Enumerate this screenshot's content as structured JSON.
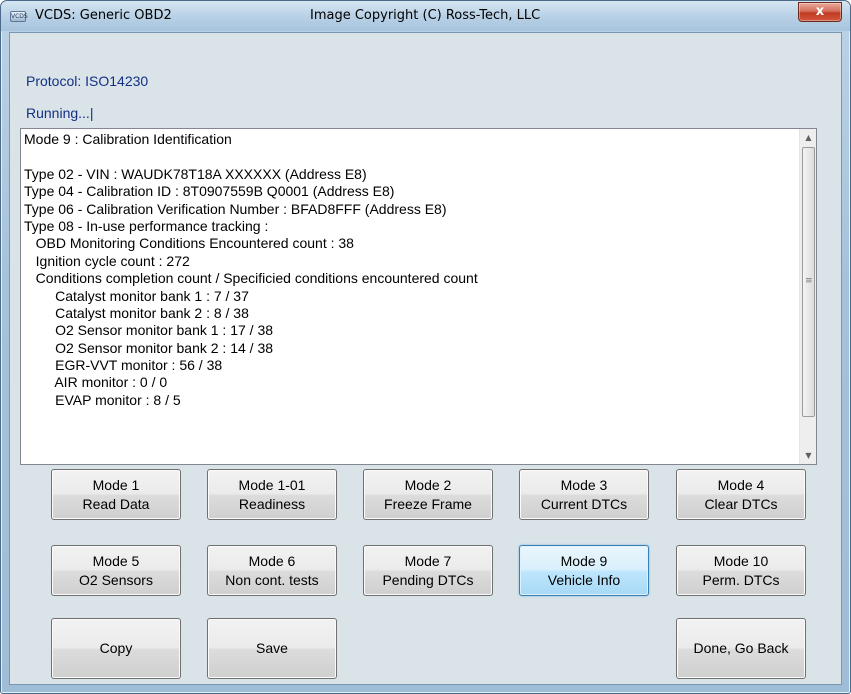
{
  "window": {
    "app_icon_label": "VCDS",
    "title": "VCDS:  Generic OBD2",
    "copyright": "Image Copyright (C) Ross-Tech, LLC",
    "close_glyph": "x"
  },
  "status": {
    "protocol": "Protocol: ISO14230",
    "running": "Running...|"
  },
  "output": {
    "lines": [
      "Mode 9 : Calibration Identification",
      "",
      "Type 02 - VIN : WAUDK78T18A XXXXXX (Address E8)",
      "Type 04 - Calibration ID : 8T0907559B Q0001 (Address E8)",
      "Type 06 - Calibration Verification Number : BFAD8FFF (Address E8)",
      "Type 08 - In-use performance tracking :",
      "   OBD Monitoring Conditions Encountered count : 38",
      "   Ignition cycle count : 272",
      "   Conditions completion count / Specificied conditions encountered count",
      "        Catalyst monitor bank 1 : 7 / 37",
      "        Catalyst monitor bank 2 : 8 / 38",
      "        O2 Sensor monitor bank 1 : 17 / 38",
      "        O2 Sensor monitor bank 2 : 14 / 38",
      "        EGR-VVT monitor : 56 / 38",
      "        AIR monitor : 0 / 0",
      "        EVAP monitor : 8 / 5"
    ],
    "scroll_up_glyph": "▲",
    "scroll_down_glyph": "▼",
    "scroll_grip_glyph": "≡"
  },
  "buttons": {
    "mode1": {
      "line1": "Mode 1",
      "line2": "Read Data"
    },
    "mode1_01": {
      "line1": "Mode 1-01",
      "line2": "Readiness"
    },
    "mode2": {
      "line1": "Mode 2",
      "line2": "Freeze Frame"
    },
    "mode3": {
      "line1": "Mode 3",
      "line2": "Current DTCs"
    },
    "mode4": {
      "line1": "Mode 4",
      "line2": "Clear DTCs"
    },
    "mode5": {
      "line1": "Mode 5",
      "line2": "O2 Sensors"
    },
    "mode6": {
      "line1": "Mode 6",
      "line2": "Non cont. tests"
    },
    "mode7": {
      "line1": "Mode 7",
      "line2": "Pending DTCs"
    },
    "mode9": {
      "line1": "Mode 9",
      "line2": "Vehicle Info"
    },
    "mode10": {
      "line1": "Mode 10",
      "line2": "Perm. DTCs"
    },
    "copy": "Copy",
    "save": "Save",
    "done": "Done, Go Back"
  },
  "colors": {
    "status_text": "#142f86",
    "active_button": "#bee6fd"
  }
}
